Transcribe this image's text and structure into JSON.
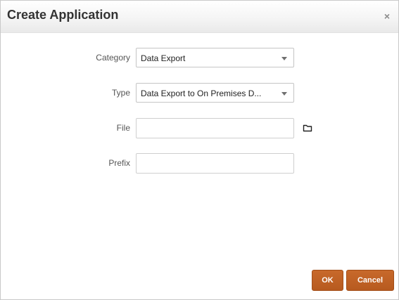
{
  "dialog": {
    "title": "Create Application",
    "close_glyph": "×",
    "close_icon": "close-icon"
  },
  "form": {
    "category": {
      "label": "Category",
      "value": "Data Export"
    },
    "type": {
      "label": "Type",
      "value": "Data Export to On Premises D..."
    },
    "file": {
      "label": "File",
      "value": "",
      "browse_icon": "folder-icon"
    },
    "prefix": {
      "label": "Prefix",
      "value": ""
    }
  },
  "footer": {
    "ok_label": "OK",
    "cancel_label": "Cancel"
  },
  "colors": {
    "button_accent": "#c0622a",
    "title_text": "#333333",
    "label_text": "#555555"
  }
}
